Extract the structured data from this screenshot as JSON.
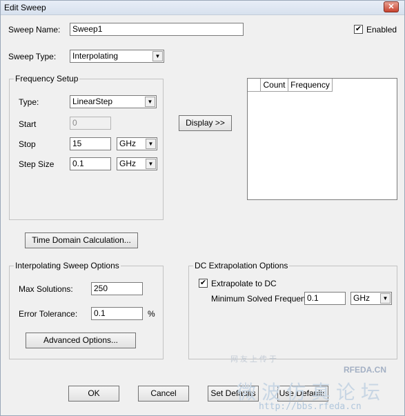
{
  "window": {
    "title": "Edit Sweep",
    "close_glyph": "✕"
  },
  "sweep_name": {
    "label": "Sweep Name:",
    "value": "Sweep1"
  },
  "enabled": {
    "label": "Enabled",
    "checked": true,
    "glyph": "✔"
  },
  "sweep_type": {
    "label": "Sweep Type:",
    "value": "Interpolating"
  },
  "frequency_setup": {
    "title": "Frequency Setup",
    "type_label": "Type:",
    "type_value": "LinearStep",
    "start_label": "Start",
    "start_value": "0",
    "stop_label": "Stop",
    "stop_value": "15",
    "stop_unit": "GHz",
    "step_label": "Step Size",
    "step_value": "0.1",
    "step_unit": "GHz"
  },
  "display_button": "Display >>",
  "table": {
    "columns": [
      "Count",
      "Frequency"
    ]
  },
  "time_domain_button": "Time Domain Calculation...",
  "interp_options": {
    "title": "Interpolating Sweep Options",
    "max_solutions_label": "Max Solutions:",
    "max_solutions_value": "250",
    "error_tol_label": "Error Tolerance:",
    "error_tol_value": "0.1",
    "error_tol_unit": "%",
    "advanced_button": "Advanced Options..."
  },
  "dc_options": {
    "title": "DC Extrapolation Options",
    "extrapolate_label": "Extrapolate to DC",
    "extrapolate_checked": true,
    "glyph": "✔",
    "min_freq_label": "Minimum Solved Frequency",
    "min_freq_value": "0.1",
    "min_freq_unit": "GHz"
  },
  "footer": {
    "ok": "OK",
    "cancel": "Cancel",
    "set_defaults": "Set Defaults",
    "use_defaults": "Use Defaults"
  },
  "watermark": {
    "top": "网友上传于",
    "brand": "RFEDA.CN",
    "cn": "微波仿真论坛",
    "url": "http://bbs.rfeda.cn"
  },
  "icons": {
    "dropdown": "chevron-down-icon",
    "arrow_glyph": "▼"
  }
}
